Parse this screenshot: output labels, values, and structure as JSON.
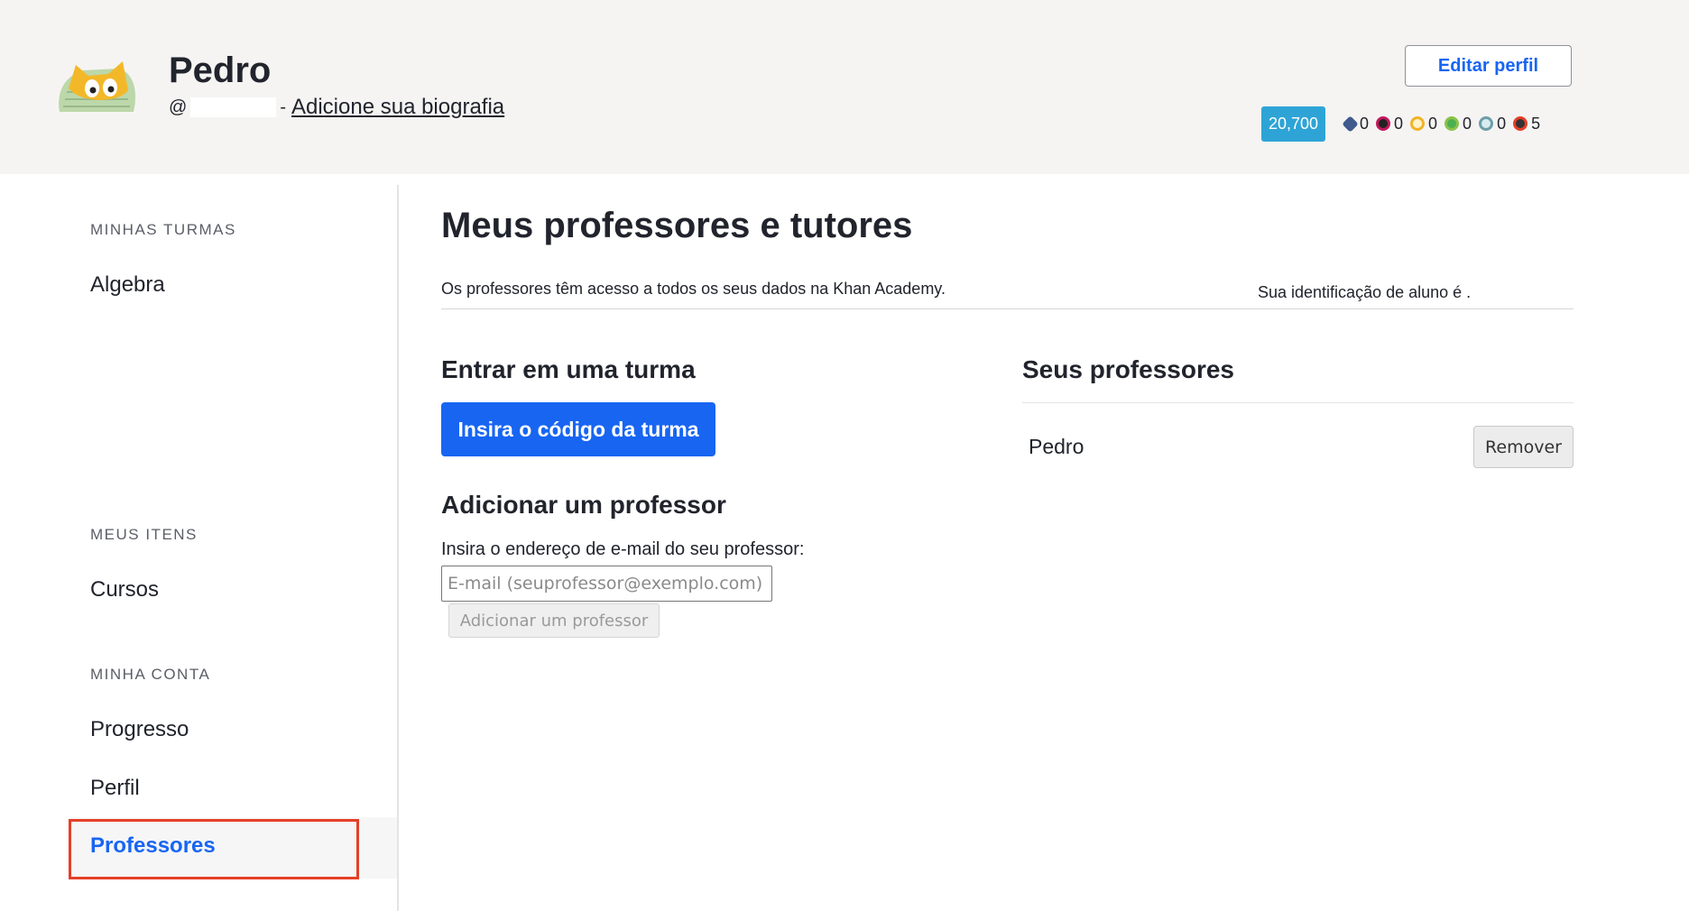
{
  "header": {
    "user_name": "Pedro",
    "handle_prefix": "@",
    "handle_separator": "-",
    "bio_link": "Adicione sua biografia",
    "edit_profile_label": "Editar perfil",
    "points": "20,700",
    "badges": [
      {
        "icon": "meteorite-badge-icon",
        "color": "#3f5a8c",
        "count": "0"
      },
      {
        "icon": "moon-badge-icon",
        "color": "#c2185b",
        "count": "0"
      },
      {
        "icon": "earth-badge-icon",
        "color": "#f0b429",
        "count": "0"
      },
      {
        "icon": "sun-badge-icon",
        "color": "#4caf50",
        "count": "0"
      },
      {
        "icon": "black-hole-badge-icon",
        "color": "#6d9eaa",
        "count": "0"
      },
      {
        "icon": "challenge-patch-icon",
        "color": "#e53f27",
        "count": "5"
      }
    ]
  },
  "sidebar": {
    "my_classes_heading": "MINHAS TURMAS",
    "classes": [
      {
        "label": "Algebra"
      }
    ],
    "my_items_heading": "MEUS ITENS",
    "items": [
      {
        "label": "Cursos"
      }
    ],
    "my_account_heading": "MINHA CONTA",
    "account": [
      {
        "label": "Progresso"
      },
      {
        "label": "Perfil"
      },
      {
        "label": "Professores",
        "active": true
      }
    ]
  },
  "main": {
    "title": "Meus professores e tutores",
    "info": "Os professores têm acesso a todos os seus dados na Khan Academy.",
    "student_id": "Sua identificação de aluno é .",
    "join_class": {
      "title": "Entrar em uma turma",
      "button": "Insira o código da turma"
    },
    "add_teacher": {
      "title": "Adicionar um professor",
      "label": "Insira o endereço de e-mail do seu professor:",
      "placeholder": "E-mail (seuprofessor@exemplo.com)",
      "button": "Adicionar um professor"
    },
    "your_teachers": {
      "title": "Seus professores",
      "teachers": [
        {
          "name": "Pedro",
          "remove_label": "Remover"
        }
      ]
    }
  },
  "colors": {
    "accent": "#1865f2",
    "highlight": "#e53f27",
    "points_badge": "#2ea4d6"
  }
}
